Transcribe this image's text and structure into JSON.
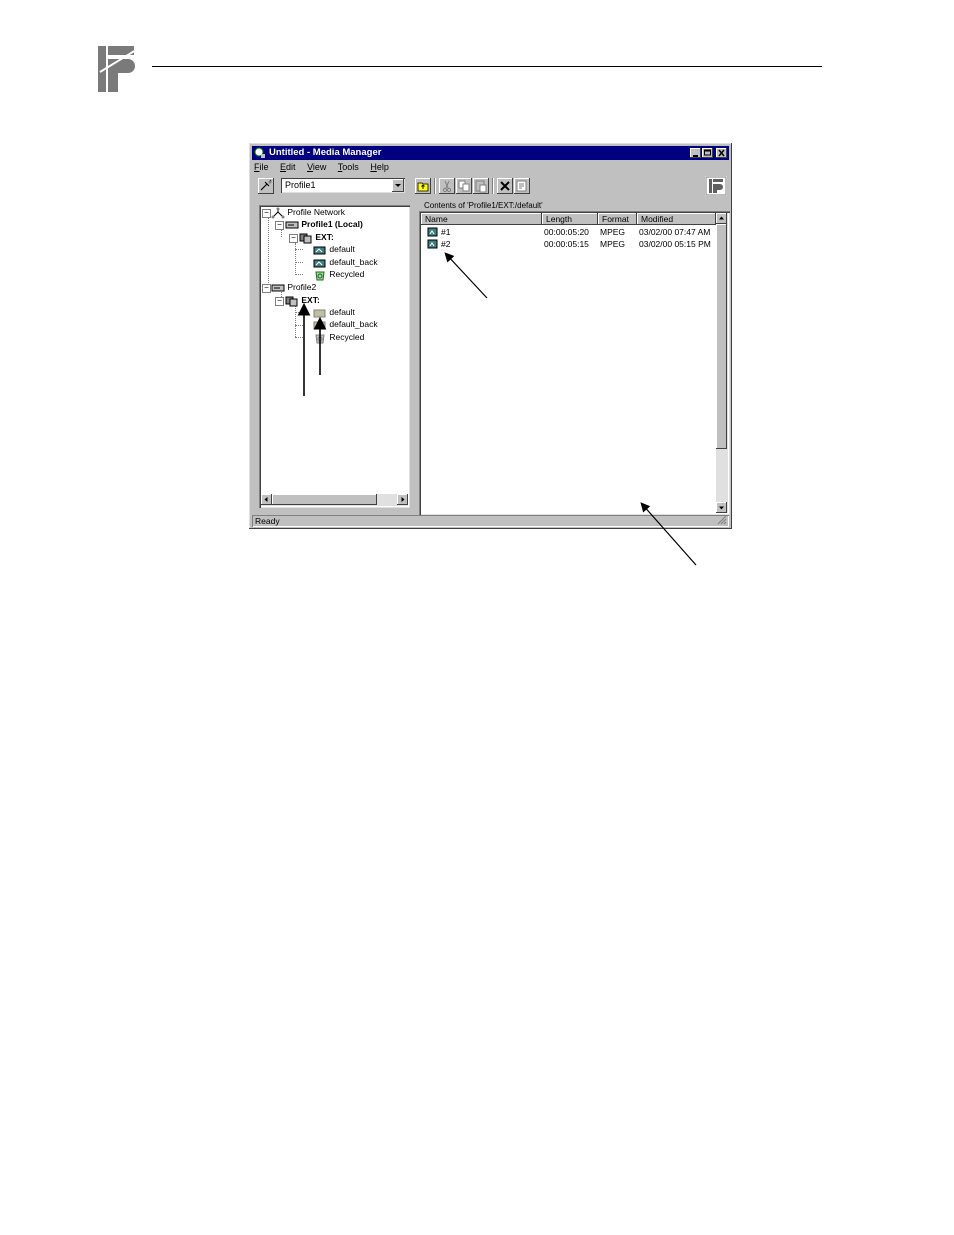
{
  "window": {
    "title": "Untitled - Media Manager",
    "controls": [
      "minimize",
      "maximize",
      "close"
    ]
  },
  "menu": [
    {
      "label": "File",
      "mnemonic": "F",
      "rest": "ile"
    },
    {
      "label": "Edit",
      "mnemonic": "E",
      "rest": "dit"
    },
    {
      "label": "View",
      "mnemonic": "V",
      "rest": "iew"
    },
    {
      "label": "Tools",
      "mnemonic": "T",
      "rest": "ools"
    },
    {
      "label": "Help",
      "mnemonic": "H",
      "rest": "elp"
    }
  ],
  "toolbar": {
    "machine_select_value": "Profile1",
    "icons": [
      "connect-icon",
      "up-folder-icon",
      "cut-icon",
      "copy-icon",
      "paste-icon",
      "delete-icon",
      "properties-icon",
      "logo-icon"
    ]
  },
  "tree": {
    "root": "Profile Network",
    "profile1": "Profile1  (Local)",
    "profile1_ext": "EXT:",
    "profile1_bins": [
      "default",
      "default_back",
      "Recycled"
    ],
    "profile2": "Profile2",
    "profile2_ext": "EXT:",
    "profile2_bins": [
      "default",
      "default_back",
      "Recycled"
    ]
  },
  "list": {
    "contents_label": "Contents of 'Profile1/EXT:/default'",
    "columns": [
      "Name",
      "Length",
      "Format",
      "Modified"
    ],
    "rows": [
      {
        "name": "#1",
        "length": "00:00:05:20",
        "format": "MPEG",
        "modified": "03/02/00 07:47 AM"
      },
      {
        "name": "#2",
        "length": "00:00:05:15",
        "format": "MPEG",
        "modified": "03/02/00 05:15 PM"
      }
    ]
  },
  "status": {
    "text": "Ready"
  },
  "colors": {
    "titlebar": "#000080",
    "face": "#c0c0c0",
    "window_bg": "#ffffff"
  }
}
